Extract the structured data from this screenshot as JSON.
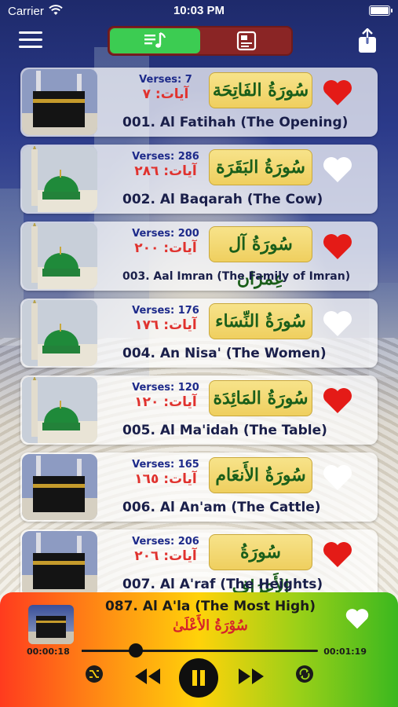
{
  "status_bar": {
    "carrier": "Carrier",
    "time": "10:03 PM"
  },
  "toolbar": {
    "menu_icon": "hamburger-icon",
    "tabs": [
      {
        "icon": "music-list-icon",
        "active": true
      },
      {
        "icon": "bookmark-card-icon",
        "active": false
      }
    ],
    "share_icon": "share-icon"
  },
  "surahs": [
    {
      "verses_en": "Verses: 7",
      "verses_ar": "آيات: ٧",
      "calligraphy": "سُورَةُ الفَاتِحَة",
      "title": "001. Al Fatihah (The Opening)",
      "favorite": true,
      "thumb": "kaaba"
    },
    {
      "verses_en": "Verses: 286",
      "verses_ar": "آيات: ٢٨٦",
      "calligraphy": "سُورَةُ البَقَرَة",
      "title": "002. Al Baqarah (The Cow)",
      "favorite": false,
      "thumb": "green-dome"
    },
    {
      "verses_en": "Verses: 200",
      "verses_ar": "آيات: ٢٠٠",
      "calligraphy": "سُورَةُ آل عِمرَان",
      "title": "003. Aal Imran (The Family of Imran)",
      "favorite": true,
      "thumb": "green-dome"
    },
    {
      "verses_en": "Verses: 176",
      "verses_ar": "آيات: ١٧٦",
      "calligraphy": "سُورَةُ النِّسَاء",
      "title": "004. An Nisa' (The Women)",
      "favorite": false,
      "thumb": "green-dome"
    },
    {
      "verses_en": "Verses: 120",
      "verses_ar": "آيات: ١٢٠",
      "calligraphy": "سُورَةُ المَائِدَة",
      "title": "005. Al Ma'idah (The Table)",
      "favorite": true,
      "thumb": "green-dome"
    },
    {
      "verses_en": "Verses: 165",
      "verses_ar": "آيات: ١٦٥",
      "calligraphy": "سُورَةُ الأَنعَام",
      "title": "006. Al An'am (The Cattle)",
      "favorite": false,
      "thumb": "kaaba"
    },
    {
      "verses_en": "Verses: 206",
      "verses_ar": "آيات: ٢٠٦",
      "calligraphy": "سُورَةُ الأَعرَاف",
      "title": "007. Al A'raf (The Heights)",
      "favorite": true,
      "thumb": "kaaba"
    }
  ],
  "player": {
    "title": "087. Al A'la (The Most High)",
    "arabic": "سُوْرَةُ الأَعْلَىٰ",
    "elapsed": "00:00:18",
    "total": "00:01:19",
    "progress": 0.23,
    "favorite": false,
    "controls": [
      "shuffle-icon",
      "rewind-icon",
      "pause-icon",
      "fast-forward-icon",
      "repeat-icon"
    ]
  },
  "colors": {
    "heart_on": "#e41b17",
    "heart_off": "#ffffff",
    "verses_en": "#1d2a8a",
    "verses_ar": "#e0322e",
    "segment_active": "#3ccc52",
    "segment_bg": "#8a2525"
  }
}
